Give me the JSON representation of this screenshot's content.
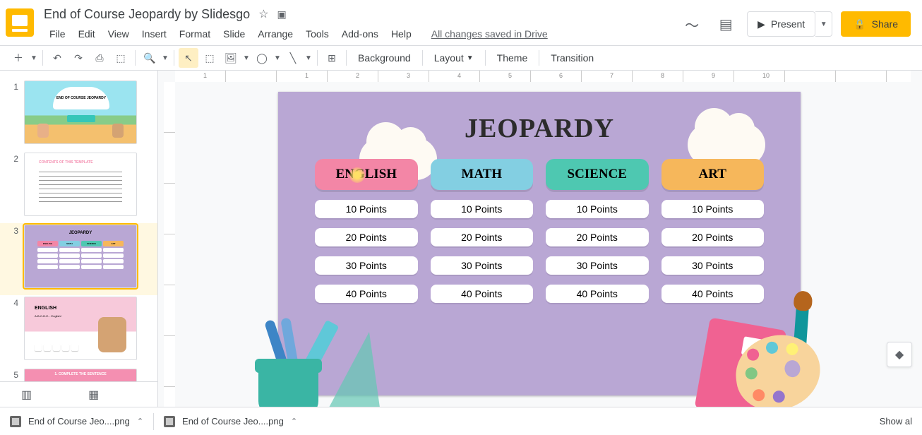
{
  "doc": {
    "title": "End of Course Jeopardy by Slidesgo",
    "save_status": "All changes saved in Drive"
  },
  "menus": [
    "File",
    "Edit",
    "View",
    "Insert",
    "Format",
    "Slide",
    "Arrange",
    "Tools",
    "Add-ons",
    "Help"
  ],
  "toolbar": {
    "background": "Background",
    "layout": "Layout",
    "theme": "Theme",
    "transition": "Transition"
  },
  "header": {
    "present": "Present",
    "share": "Share"
  },
  "ruler_marks": [
    "1",
    "",
    "1",
    "2",
    "3",
    "4",
    "5",
    "6",
    "7",
    "8",
    "9",
    "10"
  ],
  "slide": {
    "title": "JEOPARDY",
    "categories": [
      {
        "name": "ENGLISH",
        "color": "#f386a6"
      },
      {
        "name": "MATH",
        "color": "#83cfe2"
      },
      {
        "name": "SCIENCE",
        "color": "#4ec8b1"
      },
      {
        "name": "ART",
        "color": "#f6b75b"
      }
    ],
    "points": [
      "10 Points",
      "20 Points",
      "30 Points",
      "40 Points"
    ]
  },
  "thumbs": {
    "t1_title": "END OF COURSE JEOPARDY",
    "t2_title": "CONTENTS OF THIS TEMPLATE",
    "t3_title": "JEOPARDY",
    "t4_title": "ENGLISH",
    "t4_sub": "A-B-C-D-E... English!",
    "t5_title": "1. COMPLETE THE SENTENCE"
  },
  "footer": {
    "file1": "End of Course Jeo....png",
    "file2": "End of Course Jeo....png",
    "show_all": "Show al"
  }
}
